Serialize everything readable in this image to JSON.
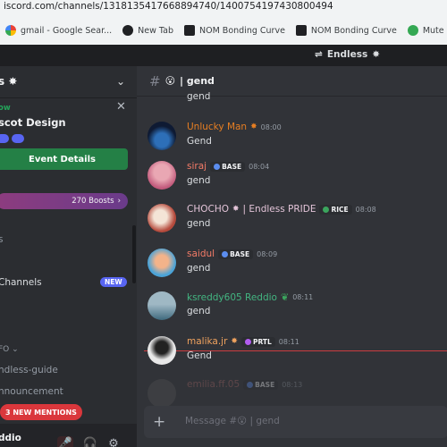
{
  "browser": {
    "url": "iscord.com/channels/1318135417668894740/1400754197430800494",
    "bookmarks": [
      {
        "label": "gmail - Google Sear...",
        "icon": "google-icon"
      },
      {
        "label": "New Tab",
        "icon": "globe-icon"
      },
      {
        "label": "NOM Bonding Curve",
        "icon": "nom-icon"
      },
      {
        "label": "NOM Bonding Curve",
        "icon": "nom-icon"
      },
      {
        "label": "Mute Switch",
        "icon": "mute-icon"
      }
    ]
  },
  "titlebar": {
    "server_name": "Endless"
  },
  "sidebar": {
    "server_name": "s",
    "event": {
      "status": "ow",
      "title": "scot Design",
      "button": "Event Details"
    },
    "boosts": "270 Boosts",
    "rows": {
      "r1": "s",
      "r2": "Channels",
      "r3": "FO",
      "r4": "ndless-guide",
      "r5": "nnouncement"
    },
    "new_badge": "NEW",
    "mentions": "3 NEW MENTIONS",
    "username": "ddio"
  },
  "channel": {
    "name": "| gend"
  },
  "messages": [
    {
      "user": "",
      "time": "",
      "text": "gend",
      "color": "#dbdee1"
    },
    {
      "user": "Unlucky Man",
      "time": "08:00",
      "text": "Gend",
      "color": "#e67e22"
    },
    {
      "user": "siraj",
      "time": "08:04",
      "text": "gend",
      "color": "#f47b67",
      "tag": "BASE"
    },
    {
      "user": "CHOCHO",
      "suffix": "| Endless PRIDE",
      "time": "08:08",
      "text": "gend",
      "color": "#e3c4d8",
      "tag": "RICE"
    },
    {
      "user": "saidul",
      "time": "08:09",
      "text": "gend",
      "color": "#f47b67",
      "tag": "BASE"
    },
    {
      "user": "ksreddy605 Reddio",
      "time": "08:11",
      "text": "gend",
      "color": "#43b581"
    },
    {
      "user": "malika.jr",
      "time": "08:11",
      "text": "Gend",
      "color": "#f0a35e",
      "tag": "PRTL"
    },
    {
      "user": "emilia.ff.05",
      "time": "08:13",
      "text": "",
      "color": "#7a6a6a",
      "tag": "BASE"
    }
  ],
  "composer": {
    "placeholder": "Message #",
    "channel": "| gend"
  }
}
